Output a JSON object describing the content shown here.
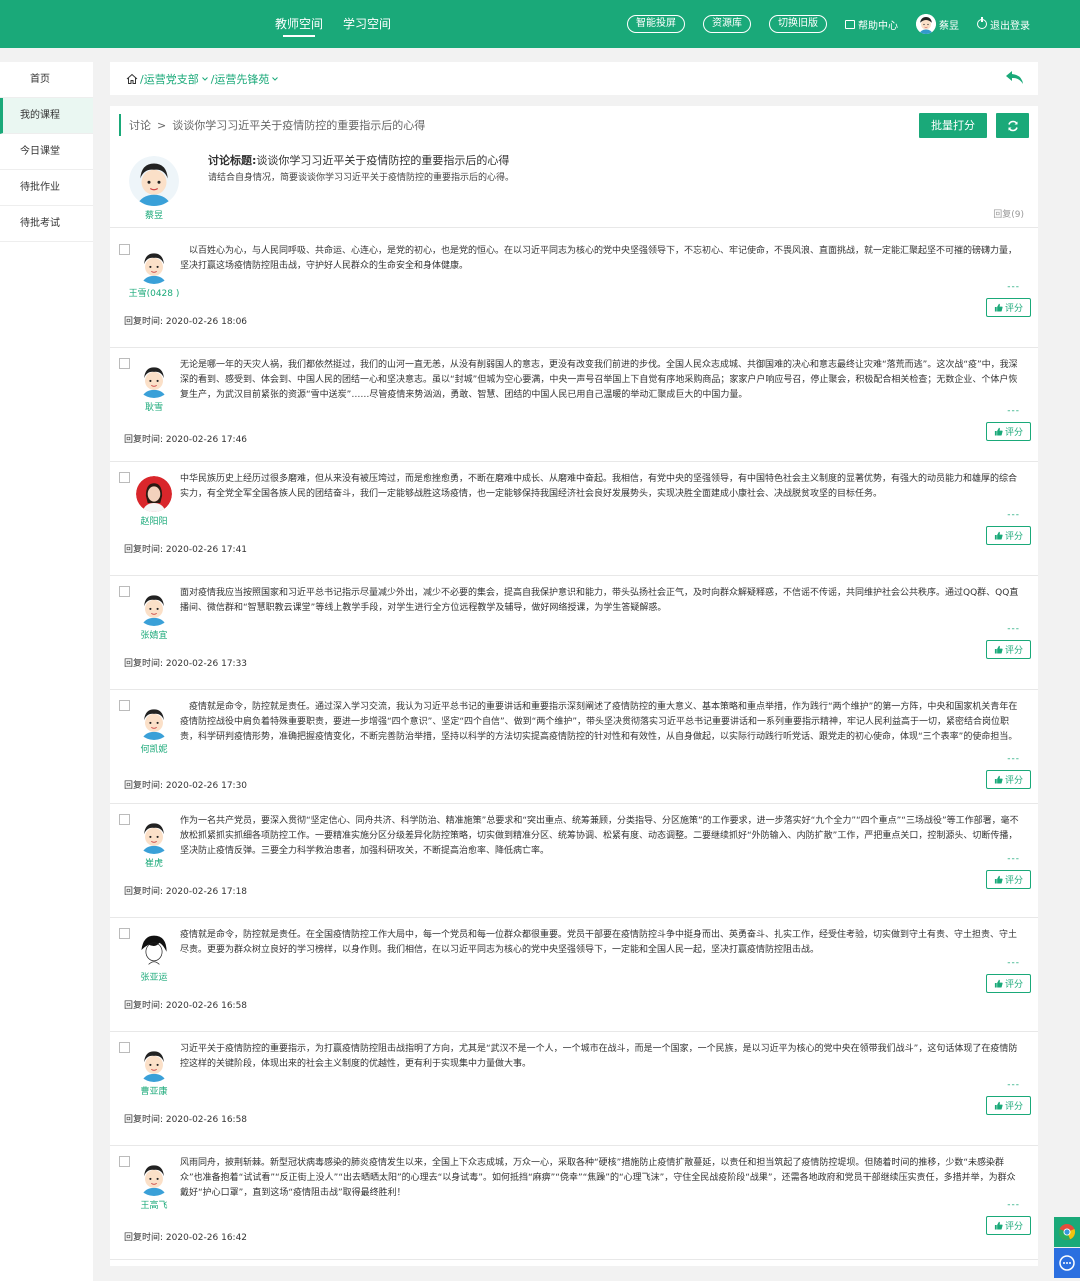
{
  "topnav": [
    {
      "label": "教师空间",
      "active": true
    },
    {
      "label": "学习空间",
      "active": false
    }
  ],
  "toolbar": {
    "smart_screen": "智能投屏",
    "resources": "资源库",
    "old_version": "切换旧版",
    "help": "帮助中心",
    "username": "蔡昱",
    "logout": "退出登录"
  },
  "sidebar": [
    {
      "label": "首页"
    },
    {
      "label": "我的课程",
      "active": true
    },
    {
      "label": "今日课堂"
    },
    {
      "label": "待批作业"
    },
    {
      "label": "待批考试"
    }
  ],
  "breadcrumb": {
    "part1": "/运营党支部",
    "part2": "/运营先锋苑"
  },
  "titlebar": {
    "section": "讨论",
    "separator": ">",
    "title": "谈谈你学习习近平关于疫情防控的重要指示后的心得"
  },
  "buttons": {
    "batch": "批量打分"
  },
  "topic": {
    "author": "蔡昱",
    "title_label": "讨论标题:",
    "title_text": "谈谈你学习习近平关于疫情防控的重要指示后的心得",
    "desc": "请结合自身情况，简要谈谈你学习习近平关于疫情防控的重要指示后的心得。",
    "replies": "回复(9)"
  },
  "reply_time_label": "回复时间:",
  "rate_label": "评分",
  "dashes": "---",
  "replies": [
    {
      "name": "王雪(0428 )",
      "avatar": "cartoon",
      "time": "2020-02-26 18:06",
      "text": "　以百姓心为心，与人民同呼吸、共命运、心连心，是党的初心，也是党的恒心。在以习近平同志为核心的党中央坚强领导下，不忘初心、牢记使命，不畏风浪、直面挑战，就一定能汇聚起坚不可摧的磅礴力量，坚决打赢这场疫情防控阻击战，守护好人民群众的生命安全和身体健康。"
    },
    {
      "name": "耿雪",
      "avatar": "cartoon",
      "time": "2020-02-26 17:46",
      "text": "无论是哪一年的天灾人祸，我们都依然挺过，我们的山河一直无恙，从没有削弱国人的意志，更没有改变我们前进的步伐。全国人民众志成城、共御国难的决心和意志最终让灾难“落荒而逃”。这次战“疫”中，我深深的看到、感受到、体会到、中国人民的团结一心和坚决意志。虽以“封城”但城为空心要满，中央一声号召举国上下自觉有序地采购商品；家家户户响应号召，停止聚会，积极配合相关检查；无数企业、个体户恢复生产，为武汉目前紧张的资源“雪中送炭”……尽管疫情来势汹汹，勇敢、智慧、团结的中国人民已用自己温暖的举动汇聚成巨大的中国力量。"
    },
    {
      "name": "赵阳阳",
      "avatar": "photo",
      "time": "2020-02-26 17:41",
      "text": "中华民族历史上经历过很多磨难，但从来没有被压垮过，而是愈挫愈勇，不断在磨难中成长、从磨难中奋起。我相信，有党中央的坚强领导，有中国特色社会主义制度的显著优势，有强大的动员能力和雄厚的综合实力，有全党全军全国各族人民的团结奋斗，我们一定能够战胜这场疫情，也一定能够保持我国经济社会良好发展势头，实现决胜全面建成小康社会、决战脱贫攻坚的目标任务。"
    },
    {
      "name": "张婧宜",
      "avatar": "cartoon",
      "time": "2020-02-26 17:33",
      "text": "面对疫情我应当按照国家和习近平总书记指示尽量减少外出，减少不必要的集会，提高自我保护意识和能力，带头弘扬社会正气，及时向群众解疑释惑，不信谣不传谣，共同维护社会公共秩序。通过QQ群、QQ直播间、微信群和“智慧职教云课堂”等线上教学手段，对学生进行全方位远程教学及辅导，做好网络授课，为学生答疑解惑。"
    },
    {
      "name": "何凯妮",
      "avatar": "cartoon",
      "time": "2020-02-26 17:30",
      "text": "　疫情就是命令，防控就是责任。通过深入学习交流，我认为习近平总书记的重要讲话和重要指示深刻阐述了疫情防控的重大意义、基本策略和重点举措，作为践行“两个维护”的第一方阵，中央和国家机关青年在疫情防控战役中肩负着特殊重要职责，要进一步增强“四个意识”、坚定“四个自信”、做到“两个维护”，带头坚决贯彻落实习近平总书记重要讲话和一系列重要指示精神，牢记人民利益高于一切，紧密结合岗位职责，科学研判疫情形势，准确把握疫情变化，不断完善防治举措，坚持以科学的方法切实提高疫情防控的针对性和有效性，从自身做起，以实际行动践行听党话、跟党走的初心使命，体现“三个表率”的使命担当。"
    },
    {
      "name": "崔虎",
      "avatar": "cartoon",
      "time": "2020-02-26 17:18",
      "text": "作为一名共产党员，要深入贯彻“坚定信心、同舟共济、科学防治、精准施策”总要求和“突出重点、统筹兼顾，分类指导、分区施策”的工作要求，进一步落实好“九个全力”“四个重点”“三场战役”等工作部署，毫不放松抓紧抓实抓细各项防控工作。一要精准实施分区分级差异化防控策略，切实做到精准分区、统筹协调、松紧有度、动态调整。二要继续抓好“外防输入、内防扩散”工作，严把重点关口，控制源头、切断传播，坚决防止疫情反弹。三要全力科学救治患者，加强科研攻关，不断提高治愈率、降低病亡率。"
    },
    {
      "name": "张亚运",
      "avatar": "sketch",
      "time": "2020-02-26 16:58",
      "text": "疫情就是命令，防控就是责任。在全国疫情防控工作大局中，每一个党员和每一位群众都很重要。党员干部要在疫情防控斗争中挺身而出、英勇奋斗、扎实工作，经受住考验，切实做到守土有责、守土担责、守土尽责。更要为群众树立良好的学习榜样，以身作则。我们相信，在以习近平同志为核心的党中央坚强领导下，一定能和全国人民一起，坚决打赢疫情防控阻击战。"
    },
    {
      "name": "曹亚康",
      "avatar": "cartoon",
      "time": "2020-02-26 16:58",
      "text": "习近平关于疫情防控的重要指示，为打赢疫情防控阻击战指明了方向，尤其是“武汉不是一个人，一个城市在战斗，而是一个国家，一个民族，是以习近平为核心的党中央在领带我们战斗”，这句话体现了在疫情防控这样的关键阶段，体现出来的社会主义制度的优越性，更有利于实现集中力量做大事。"
    },
    {
      "name": "王高飞",
      "avatar": "cartoon",
      "time": "2020-02-26 16:42",
      "text": "风雨同舟，披荆斩棘。新型冠状病毒感染的肺炎疫情发生以来，全国上下众志成城，万众一心，采取各种“硬核”措施防止疫情扩散蔓延，以责任和担当筑起了疫情防控堤坝。但随着时间的推移，少数“未感染群众”也准备抱着“试试看”“反正街上没人”“出去晒晒太阳”的心理去“以身试毒”。如何抵挡“麻痹”“侥幸”“焦躁”的“心理飞沫”，守住全民战疫阶段“战果”，还需各地政府和党员干部继续压实责任，多措并举，为群众戴好“护心口罩”，直到这场“疫情阻击战”取得最终胜利！"
    }
  ],
  "colors": {
    "brand": "#1aa979",
    "float_blue": "#2b6fe0"
  }
}
